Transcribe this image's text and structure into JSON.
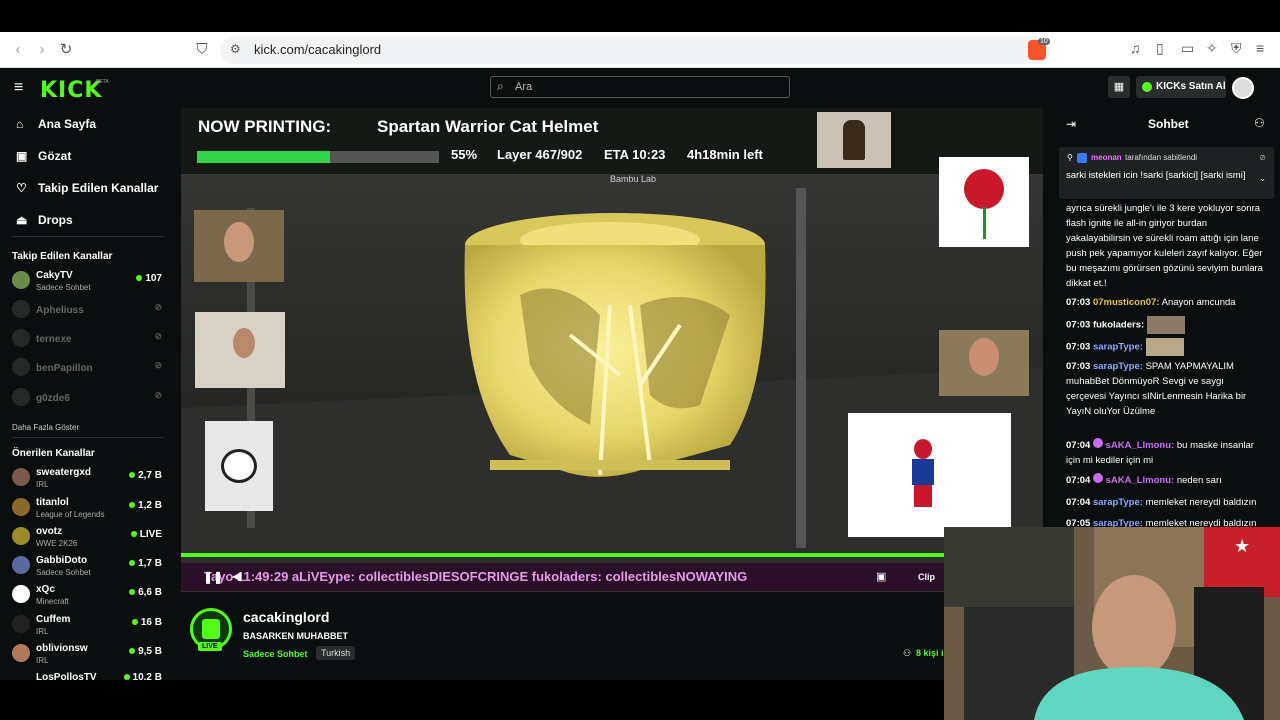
{
  "browser": {
    "url": "kick.com/cacakinglord",
    "brave_badge": "10"
  },
  "header": {
    "logo": "KICK",
    "logo_beta": "BETA",
    "search_placeholder": "Ara",
    "kicks_button": "KICKs Satın Al"
  },
  "sidebar": {
    "nav": [
      {
        "label": "Ana Sayfa",
        "icon": "home-icon"
      },
      {
        "label": "Gözat",
        "icon": "browse-icon"
      },
      {
        "label": "Takip Edilen Kanallar",
        "icon": "heart-icon"
      },
      {
        "label": "Drops",
        "icon": "drops-icon"
      }
    ],
    "followed_title": "Takip Edilen Kanallar",
    "followed": [
      {
        "name": "CakyTV",
        "sub": "Sadece Sohbet",
        "viewers": "107",
        "live": true
      },
      {
        "name": "Apheliuss",
        "live": false
      },
      {
        "name": "ternexe",
        "live": false
      },
      {
        "name": "benPapillon",
        "live": false
      },
      {
        "name": "g0zde6",
        "live": false
      }
    ],
    "show_more": "Daha Fazla Göster",
    "recommended_title": "Önerilen Kanallar",
    "recommended": [
      {
        "name": "sweatergxd",
        "sub": "IRL",
        "viewers": "2,7 B"
      },
      {
        "name": "titanlol",
        "sub": "League of Legends",
        "viewers": "1,2 B"
      },
      {
        "name": "ovotz",
        "sub": "WWE 2K26",
        "viewers": "LIVE"
      },
      {
        "name": "GabbiDoto",
        "sub": "Sadece Sohbet",
        "viewers": "1,7 B"
      },
      {
        "name": "xQc",
        "sub": "Minecraft",
        "viewers": "6,6 B"
      },
      {
        "name": "Cuffem",
        "sub": "IRL",
        "viewers": "16 B"
      },
      {
        "name": "oblivionsw",
        "sub": "IRL",
        "viewers": "9,5 B"
      },
      {
        "name": "LosPollosTV",
        "sub": "",
        "viewers": "10,2 B"
      }
    ]
  },
  "stream": {
    "now_printing_label": "NOW PRINTING:",
    "print_name": "Spartan Warrior Cat Helmet",
    "progress_pct": "55%",
    "progress": 0.55,
    "layer": "Layer 467/902",
    "eta": "ETA 10:23",
    "time_left": "4h18min left",
    "brand": "Bambu Lab",
    "ticker_text": "Tayo    11:49:29  aLiVEype: collectiblesDIESOFCRINGE     fukoladers: collectiblesNOWAYING",
    "clip_label": "Clip"
  },
  "channel": {
    "name": "cacakinglord",
    "title": "BASARKEN MUHABBET",
    "category": "Sadece Sohbet",
    "tag": "Turkish",
    "live_badge": "LIVE",
    "viewers": "8 kişi i"
  },
  "chat": {
    "title": "Sohbet",
    "pinned_by": "meonan",
    "pinned_by_suffix": "tarafından sabitlendi",
    "pinned_text": "sarki istekleri icin !sarki [sarkici] [sarki ismi]",
    "messages": [
      {
        "time": "",
        "user": "",
        "text": "ayrıca sürekli jungle'ı ile 3 kere yokluyor sonra flash ignite ile all-in giriyor burdan yakalayabilirsin ve sürekli roam attığı için lane push pek yapamıyor kuleleri zayıf kalıyor. Eğer bu meşazımı görürsen gözünü seviyim bunlara dikkat et.!"
      },
      {
        "time": "07:03",
        "user": "07musticon07:",
        "text": "Anayon amcunda",
        "color": "#e6c229"
      },
      {
        "time": "07:03",
        "user": "fukoladers:",
        "text": "",
        "color": "#ffffff"
      },
      {
        "time": "07:03",
        "user": "sarapType:",
        "text": "",
        "color": "#8fa6ff"
      },
      {
        "time": "07:03",
        "user": "sarapType:",
        "text": "SPAM YAPMAYALIM muhabBet DönmüyoR Sevgi ve saygı çerçevesi Yayıncı sINirLenmesin Harika bir YayıN oluYor Üzülme",
        "color": "#8fa6ff"
      },
      {
        "time": "07:04",
        "user": "sAKA_Llmonu:",
        "text": "bu maske insanlar için mi kediler için mi",
        "color": "#c96cf0"
      },
      {
        "time": "07:04",
        "user": "sAKA_Llmonu:",
        "text": "neden sarı",
        "color": "#c96cf0"
      },
      {
        "time": "07:04",
        "user": "sarapType:",
        "text": "memleket nereydi baldızın",
        "color": "#8fa6ff"
      },
      {
        "time": "07:05",
        "user": "sarapType:",
        "text": "memleket nereydi baldızın",
        "color": "#8fa6ff"
      }
    ]
  },
  "colors": {
    "accent": "#53fc18",
    "background": "#0b0e0f",
    "printer_yellow": "#efe27a"
  }
}
